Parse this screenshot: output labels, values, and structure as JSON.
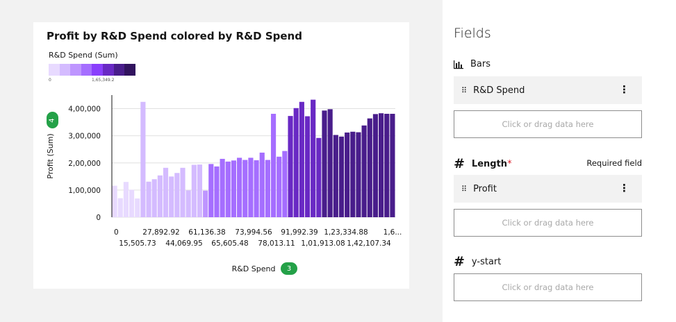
{
  "chart": {
    "title": "Profit by R&D Spend colored by R&D Spend",
    "legend_title": "R&D Spend (Sum)",
    "legend_min": "0",
    "legend_max": "1,65,349.2",
    "legend_colors": [
      "#e8daff",
      "#d4bbff",
      "#be95ff",
      "#a56eff",
      "#8a3ffc",
      "#6929c4",
      "#491d8b",
      "#31135e"
    ],
    "ylabel": "Profit (Sum)",
    "xlabel": "R&D Spend",
    "y_badge": "4",
    "x_badge": "3"
  },
  "chart_data": {
    "type": "bar",
    "title": "Profit by R&D Spend colored by R&D Spend",
    "xlabel": "R&D Spend",
    "ylabel": "Profit (Sum)",
    "ylim": [
      0,
      450000
    ],
    "y_ticks": [
      "0",
      "1,00,000",
      "2,00,000",
      "3,00,000",
      "4,00,000"
    ],
    "x_tick_labels_row1": [
      "0",
      "27,892.92",
      "61,136.38",
      "73,994.56",
      "91,992.39",
      "1,23,334.88",
      "1,6..."
    ],
    "x_tick_labels_row2": [
      "15,505.73",
      "44,069.95",
      "65,605.48",
      "78,013.11",
      "1,01,913.08",
      "1,42,107.34"
    ],
    "legend": "top-left",
    "grid": true,
    "values": [
      116000,
      70000,
      130000,
      101000,
      69000,
      425000,
      131000,
      140000,
      154000,
      182000,
      150000,
      163000,
      182000,
      99000,
      193000,
      194000,
      98000,
      196000,
      187000,
      215000,
      205000,
      209000,
      219000,
      211000,
      219000,
      210000,
      238000,
      211000,
      381000,
      223000,
      244000,
      373000,
      402000,
      425000,
      372000,
      433000,
      292000,
      393000,
      398000,
      303000,
      297000,
      312000,
      315000,
      313000,
      338000,
      364000,
      380000,
      383000,
      381000,
      381000
    ],
    "color_levels": [
      0,
      0,
      0,
      0,
      0,
      1,
      1,
      1,
      1,
      1,
      1,
      1,
      1,
      1,
      1,
      1,
      2,
      3,
      3,
      3,
      3,
      3,
      3,
      3,
      3,
      3,
      3,
      3,
      3,
      3,
      3,
      5,
      5,
      5,
      5,
      5,
      5,
      6,
      6,
      6,
      6,
      6,
      6,
      6,
      6,
      6,
      6,
      6,
      6,
      6
    ]
  },
  "panel": {
    "title": "Fields",
    "bars_label": "Bars",
    "bars_field": "R&D Spend",
    "drop_placeholder": "Click or drag data here",
    "length_label": "Length",
    "required_star": "*",
    "required_label": "Required field",
    "length_field": "Profit",
    "ystart_label": "y-start",
    "hash": "#",
    "drag_glyph": "⠿",
    "kebab_glyph": "⋮"
  }
}
